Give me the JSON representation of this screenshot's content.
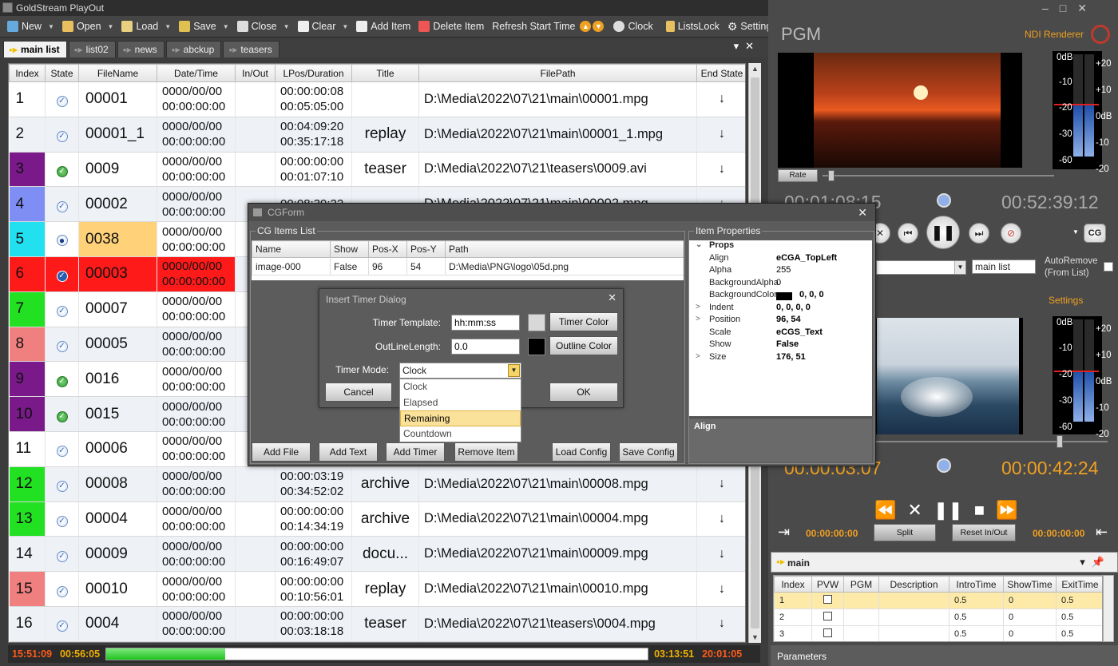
{
  "app": {
    "title": "GoldStream PlayOut"
  },
  "toolbar": {
    "new": "New",
    "open": "Open",
    "load": "Load",
    "save": "Save",
    "close": "Close",
    "clear": "Clear",
    "add_item": "Add Item",
    "delete_item": "Delete Item",
    "refresh_start_time": "Refresh Start Time",
    "clock": "Clock",
    "lists_lock": "ListsLock",
    "settings": "Settings"
  },
  "tabs": [
    "main list",
    "list02",
    "news",
    "abckup",
    "teasers"
  ],
  "playlist": {
    "columns": [
      "Index",
      "State",
      "FileName",
      "Date/Time",
      "In/Out",
      "LPos/Duration",
      "Title",
      "FilePath",
      "End State"
    ],
    "rows": [
      {
        "index": "1",
        "color": "",
        "state": "check",
        "file": "00001",
        "date": "0000/00/00",
        "time": "00:00:00:00",
        "lpos": "00:00:00:08",
        "dur": "00:05:05:00",
        "title": "",
        "path": "D:\\Media\\2022\\07\\21\\main\\00001.mpg",
        "end": "↓"
      },
      {
        "index": "2",
        "color": "",
        "state": "check",
        "file": "00001_1",
        "date": "0000/00/00",
        "time": "00:00:00:00",
        "lpos": "00:04:09:20",
        "dur": "00:35:17:18",
        "title": "replay",
        "path": "D:\\Media\\2022\\07\\21\\main\\00001_1.mpg",
        "end": "↓"
      },
      {
        "index": "3",
        "color": "#7a1a8a",
        "state": "green",
        "file": "0009",
        "date": "0000/00/00",
        "time": "00:00:00:00",
        "lpos": "00:00:00:00",
        "dur": "00:01:07:10",
        "title": "teaser",
        "path": "D:\\Media\\2022\\07\\21\\teasers\\0009.avi",
        "end": "↓"
      },
      {
        "index": "4",
        "color": "#7f8ef5",
        "state": "check",
        "file": "00002",
        "date": "0000/00/00",
        "time": "00:00:00:00",
        "lpos": "00:08:39:22",
        "dur": "",
        "title": "",
        "path": "D:\\Media\\2022\\07\\21\\main\\00002.mpg",
        "end": "↓"
      },
      {
        "index": "5",
        "color": "#22e0f0",
        "state": "eye",
        "file": "0038",
        "date": "0000/00/00",
        "time": "00:00:00:00",
        "lpos": "",
        "dur": "",
        "title": "",
        "path": "",
        "end": ""
      },
      {
        "index": "6",
        "color": "#ff1a1a",
        "state": "blue",
        "file": "00003",
        "date": "0000/00/00",
        "time": "00:00:00:00",
        "lpos": "",
        "dur": "",
        "title": "",
        "path": "",
        "end": ""
      },
      {
        "index": "7",
        "color": "#22e022",
        "state": "check",
        "file": "00007",
        "date": "0000/00/00",
        "time": "00:00:00:00",
        "lpos": "",
        "dur": "",
        "title": "",
        "path": "",
        "end": ""
      },
      {
        "index": "8",
        "color": "#f08080",
        "state": "check",
        "file": "00005",
        "date": "0000/00/00",
        "time": "00:00:00:00",
        "lpos": "",
        "dur": "",
        "title": "",
        "path": "",
        "end": ""
      },
      {
        "index": "9",
        "color": "#7a1a8a",
        "state": "green",
        "file": "0016",
        "date": "0000/00/00",
        "time": "00:00:00:00",
        "lpos": "",
        "dur": "",
        "title": "",
        "path": "",
        "end": ""
      },
      {
        "index": "10",
        "color": "#7a1a8a",
        "state": "green",
        "file": "0015",
        "date": "0000/00/00",
        "time": "00:00:00:00",
        "lpos": "",
        "dur": "",
        "title": "",
        "path": "",
        "end": ""
      },
      {
        "index": "11",
        "color": "",
        "state": "check",
        "file": "00006",
        "date": "0000/00/00",
        "time": "00:00:00:00",
        "lpos": "",
        "dur": "",
        "title": "",
        "path": "",
        "end": ""
      },
      {
        "index": "12",
        "color": "#22e022",
        "state": "check",
        "file": "00008",
        "date": "0000/00/00",
        "time": "00:00:00:00",
        "lpos": "00:00:03:19",
        "dur": "00:34:52:02",
        "title": "archive",
        "path": "D:\\Media\\2022\\07\\21\\main\\00008.mpg",
        "end": "↓"
      },
      {
        "index": "13",
        "color": "#22e022",
        "state": "check",
        "file": "00004",
        "date": "0000/00/00",
        "time": "00:00:00:00",
        "lpos": "00:00:00:00",
        "dur": "00:14:34:19",
        "title": "archive",
        "path": "D:\\Media\\2022\\07\\21\\main\\00004.mpg",
        "end": "↓"
      },
      {
        "index": "14",
        "color": "",
        "state": "check",
        "file": "00009",
        "date": "0000/00/00",
        "time": "00:00:00:00",
        "lpos": "00:00:00:00",
        "dur": "00:16:49:07",
        "title": "docu...",
        "path": "D:\\Media\\2022\\07\\21\\main\\00009.mpg",
        "end": "↓"
      },
      {
        "index": "15",
        "color": "#f08080",
        "state": "check",
        "file": "00010",
        "date": "0000/00/00",
        "time": "00:00:00:00",
        "lpos": "00:00:00:00",
        "dur": "00:10:56:01",
        "title": "replay",
        "path": "D:\\Media\\2022\\07\\21\\main\\00010.mpg",
        "end": "↓"
      },
      {
        "index": "16",
        "color": "",
        "state": "check",
        "file": "0004",
        "date": "0000/00/00",
        "time": "00:00:00:00",
        "lpos": "00:00:00:00",
        "dur": "00:03:18:18",
        "title": "teaser",
        "path": "D:\\Media\\2022\\07\\21\\teasers\\0004.mpg",
        "end": "↓"
      }
    ]
  },
  "status": {
    "clock": "15:51:09",
    "elapsed": "00:56:05",
    "remaining": "03:13:51",
    "end": "20:01:05",
    "progress": 0.22
  },
  "pgm": {
    "label": "PGM",
    "ndi": "NDI Renderer",
    "rate": "Rate",
    "time_left": "00:01:08:15",
    "time_right": "00:52:39:12",
    "cg": "CG",
    "list_combo": "main list",
    "auto_remove": "AutoRemove (From List)",
    "settings": "Settings",
    "meter_labels": [
      "0dB",
      "-10",
      "-20",
      "-30",
      "-60"
    ],
    "meter_labels_right": [
      "+20",
      "+10",
      "0dB",
      "-10",
      "-20"
    ]
  },
  "pvw": {
    "time_left": "00:00:03:07",
    "time_right": "00:00:42:24",
    "in_time": "00:00:00:00",
    "out_time": "00:00:00:00",
    "split": "Split",
    "reset": "Reset In/Out"
  },
  "cgpanel": {
    "tab": "main",
    "columns": [
      "Index",
      "PVW",
      "PGM",
      "Description",
      "IntroTime",
      "ShowTime",
      "ExitTime"
    ],
    "rows": [
      {
        "index": "1",
        "intro": "0.5",
        "show": "0",
        "exit": "0.5"
      },
      {
        "index": "2",
        "intro": "0.5",
        "show": "0",
        "exit": "0.5"
      },
      {
        "index": "3",
        "intro": "0.5",
        "show": "0",
        "exit": "0.5"
      }
    ],
    "parameters": "Parameters"
  },
  "cgform": {
    "title": "CGForm",
    "items_label": "CG Items List",
    "props_label": "Item Properties",
    "columns": [
      "Name",
      "Show",
      "Pos-X",
      "Pos-Y",
      "Path"
    ],
    "row": {
      "name": "image-000",
      "show": "False",
      "posx": "96",
      "posy": "54",
      "path": "D:\\Media\\PNG\\logo\\05d.png"
    },
    "buttons": {
      "add_file": "Add File",
      "add_text": "Add Text",
      "add_timer": "Add Timer",
      "remove_item": "Remove Item",
      "load_config": "Load Config",
      "save_config": "Save Config"
    },
    "props_group": "Props",
    "props": [
      {
        "k": "Align",
        "v": "eCGA_TopLeft",
        "b": true,
        "exp": ""
      },
      {
        "k": "Alpha",
        "v": "255",
        "b": false,
        "exp": ""
      },
      {
        "k": "BackgroundAlpha",
        "v": "0",
        "b": false,
        "exp": ""
      },
      {
        "k": "BackgroundColor",
        "v": "0, 0, 0",
        "b": true,
        "exp": "",
        "swatch": true
      },
      {
        "k": "Indent",
        "v": "0, 0, 0, 0",
        "b": true,
        "exp": ">"
      },
      {
        "k": "Position",
        "v": "96, 54",
        "b": true,
        "exp": ">"
      },
      {
        "k": "Scale",
        "v": "eCGS_Text",
        "b": true,
        "exp": ""
      },
      {
        "k": "Show",
        "v": "False",
        "b": true,
        "exp": ""
      },
      {
        "k": "Size",
        "v": "176, 51",
        "b": true,
        "exp": ">"
      }
    ],
    "prop_desc": "Align"
  },
  "timer_dialog": {
    "title": "Insert Timer Dialog",
    "template_label": "Timer Template:",
    "template_value": "hh:mm:ss",
    "timer_color": "Timer Color",
    "outline_label": "OutLineLength:",
    "outline_value": "0.0",
    "outline_color": "Outline Color",
    "mode_label": "Timer Mode:",
    "mode_value": "Clock",
    "options": [
      "Clock",
      "Elapsed",
      "Remaining",
      "Countdown"
    ],
    "highlighted": 2,
    "cancel": "Cancel",
    "ok": "OK"
  },
  "colors": {
    "accent": "#f0a020",
    "status_red": "#ff5a1a"
  }
}
